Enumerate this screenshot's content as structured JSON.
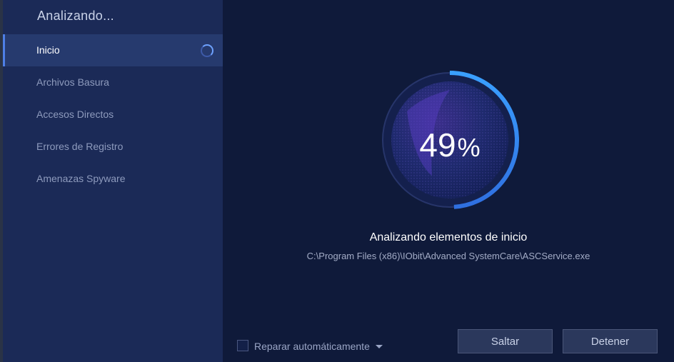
{
  "sidebar": {
    "title": "Analizando...",
    "items": [
      {
        "label": "Inicio",
        "active": true
      },
      {
        "label": "Archivos Basura"
      },
      {
        "label": "Accesos Directos"
      },
      {
        "label": "Errores de Registro"
      },
      {
        "label": "Amenazas Spyware"
      }
    ]
  },
  "scan": {
    "percent_value": "49",
    "percent_symbol": "%",
    "progress": 0.49,
    "status_title": "Analizando elementos de inicio",
    "current_path": "C:\\Program Files (x86)\\IObit\\Advanced SystemCare\\ASCService.exe"
  },
  "footer": {
    "auto_repair_label": "Reparar automáticamente",
    "skip_label": "Saltar",
    "stop_label": "Detener"
  },
  "colors": {
    "sidebar_bg": "#1b2a57",
    "main_bg": "#0f1a3a",
    "accent": "#3f8cff"
  }
}
